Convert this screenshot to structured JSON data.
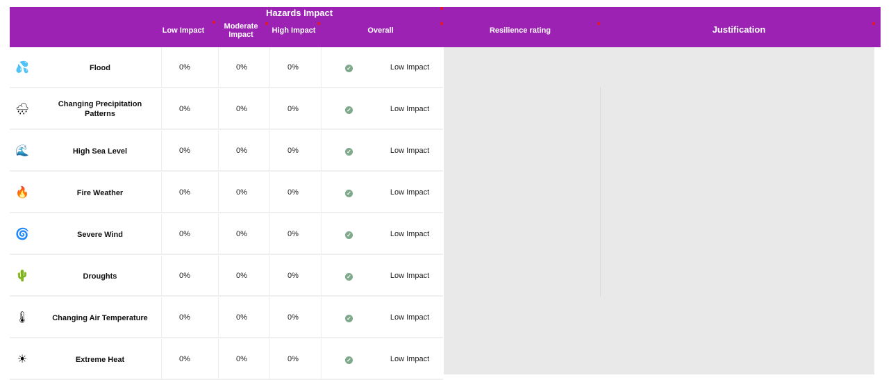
{
  "header": {
    "group_title": "Hazards Impact",
    "columns": {
      "low": "Low Impact",
      "moderate_line1": "Moderate",
      "moderate_line2": "Impact",
      "high": "High Impact",
      "overall": "Overall",
      "resilience": "Resilience rating",
      "justification": "Justification"
    }
  },
  "colors": {
    "header_bg": "#9b22b3",
    "status_ok": "#7fa98b",
    "marker": "#e0182d"
  },
  "rows": [
    {
      "icon": "water-drops-icon",
      "glyph": "💦",
      "name_line1": "Flood",
      "name_line2": "",
      "low": "0%",
      "moderate": "0%",
      "high": "0%",
      "overall": "Low Impact"
    },
    {
      "icon": "rain-cloud-icon",
      "glyph": "🌧",
      "name_line1": "Changing Precipitation",
      "name_line2": "Patterns",
      "low": "0%",
      "moderate": "0%",
      "high": "0%",
      "overall": "Low Impact"
    },
    {
      "icon": "sea-wave-icon",
      "glyph": "🌊",
      "name_line1": "High Sea Level",
      "name_line2": "",
      "low": "0%",
      "moderate": "0%",
      "high": "0%",
      "overall": "Low Impact"
    },
    {
      "icon": "fire-icon",
      "glyph": "🔥",
      "name_line1": "Fire Weather",
      "name_line2": "",
      "low": "0%",
      "moderate": "0%",
      "high": "0%",
      "overall": "Low Impact"
    },
    {
      "icon": "wind-icon",
      "glyph": "🌀",
      "name_line1": "Severe Wind",
      "name_line2": "",
      "low": "0%",
      "moderate": "0%",
      "high": "0%",
      "overall": "Low Impact"
    },
    {
      "icon": "cactus-icon",
      "glyph": "🌵",
      "name_line1": "Droughts",
      "name_line2": "",
      "low": "0%",
      "moderate": "0%",
      "high": "0%",
      "overall": "Low Impact"
    },
    {
      "icon": "thermometer-icon",
      "glyph": "🌡",
      "name_line1": "Changing Air Temperature",
      "name_line2": "",
      "low": "0%",
      "moderate": "0%",
      "high": "0%",
      "overall": "Low Impact"
    },
    {
      "icon": "sun-icon",
      "glyph": "☀",
      "name_line1": "Extreme Heat",
      "name_line2": "",
      "low": "0%",
      "moderate": "0%",
      "high": "0%",
      "overall": "Low Impact"
    }
  ]
}
